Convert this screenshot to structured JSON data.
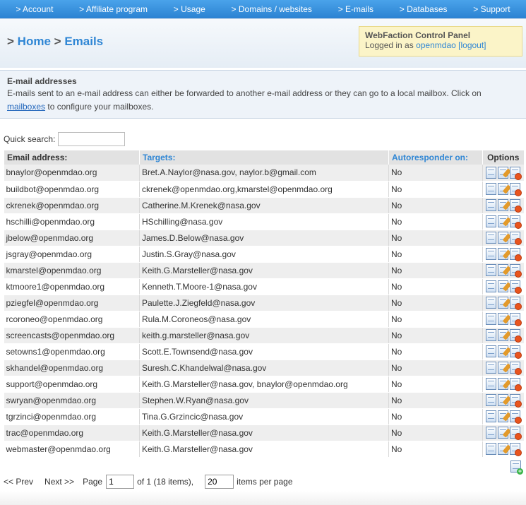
{
  "nav": [
    "> Account",
    "> Affiliate program",
    "> Usage",
    "> Domains / websites",
    "> E-mails",
    "> Databases",
    "> Support"
  ],
  "breadcrumb": {
    "sep": ">",
    "home": "Home",
    "current": "Emails"
  },
  "panel": {
    "title": "WebFaction Control Panel",
    "logged_in_text": "Logged in as",
    "user": "openmdao",
    "logout": "[logout]"
  },
  "info": {
    "title": "E-mail addresses",
    "text_before": "E-mails sent to an e-mail address can either be forwarded to another e-mail address or they can go to a local mailbox. Click on",
    "link": "mailboxes",
    "text_after": "to configure your mailboxes."
  },
  "search": {
    "label": "Quick search:",
    "value": ""
  },
  "table": {
    "headers": {
      "email": "Email address:",
      "targets": "Targets:",
      "autoresponder": "Autoresponder on:",
      "options": "Options"
    },
    "rows": [
      {
        "email": "bnaylor@openmdao.org",
        "targets": "Bret.A.Naylor@nasa.gov, naylor.b@gmail.com",
        "auto": "No"
      },
      {
        "email": "buildbot@openmdao.org",
        "targets": "ckrenek@openmdao.org,kmarstel@openmdao.org",
        "auto": "No"
      },
      {
        "email": "ckrenek@openmdao.org",
        "targets": "Catherine.M.Krenek@nasa.gov",
        "auto": "No"
      },
      {
        "email": "hschilli@openmdao.org",
        "targets": "HSchilling@nasa.gov",
        "auto": "No"
      },
      {
        "email": "jbelow@openmdao.org",
        "targets": "James.D.Below@nasa.gov",
        "auto": "No"
      },
      {
        "email": "jsgray@openmdao.org",
        "targets": "Justin.S.Gray@nasa.gov",
        "auto": "No"
      },
      {
        "email": "kmarstel@openmdao.org",
        "targets": "Keith.G.Marsteller@nasa.gov",
        "auto": "No"
      },
      {
        "email": "ktmoore1@openmdao.org",
        "targets": "Kenneth.T.Moore-1@nasa.gov",
        "auto": "No"
      },
      {
        "email": "pziegfel@openmdao.org",
        "targets": "Paulette.J.Ziegfeld@nasa.gov",
        "auto": "No"
      },
      {
        "email": "rcoroneo@openmdao.org",
        "targets": "Rula.M.Coroneos@nasa.gov",
        "auto": "No"
      },
      {
        "email": "screencasts@openmdao.org",
        "targets": "keith.g.marsteller@nasa.gov",
        "auto": "No"
      },
      {
        "email": "setowns1@openmdao.org",
        "targets": "Scott.E.Townsend@nasa.gov",
        "auto": "No"
      },
      {
        "email": "skhandel@openmdao.org",
        "targets": "Suresh.C.Khandelwal@nasa.gov",
        "auto": "No"
      },
      {
        "email": "support@openmdao.org",
        "targets": "Keith.G.Marsteller@nasa.gov, bnaylor@openmdao.org",
        "auto": "No"
      },
      {
        "email": "swryan@openmdao.org",
        "targets": "Stephen.W.Ryan@nasa.gov",
        "auto": "No"
      },
      {
        "email": "tgrzinci@openmdao.org",
        "targets": "Tina.G.Grzincic@nasa.gov",
        "auto": "No"
      },
      {
        "email": "trac@openmdao.org",
        "targets": "Keith.G.Marsteller@nasa.gov",
        "auto": "No"
      },
      {
        "email": "webmaster@openmdao.org",
        "targets": "Keith.G.Marsteller@nasa.gov",
        "auto": "No"
      }
    ],
    "row_icons": [
      "view-icon",
      "edit-icon",
      "delete-icon"
    ],
    "add_icon": "add-icon"
  },
  "pager": {
    "prev": "<< Prev",
    "next": "Next >>",
    "page_label": "Page",
    "page_value": "1",
    "of_text": "of 1 (18 items),",
    "per_page_value": "20",
    "per_page_label": "items per page"
  }
}
